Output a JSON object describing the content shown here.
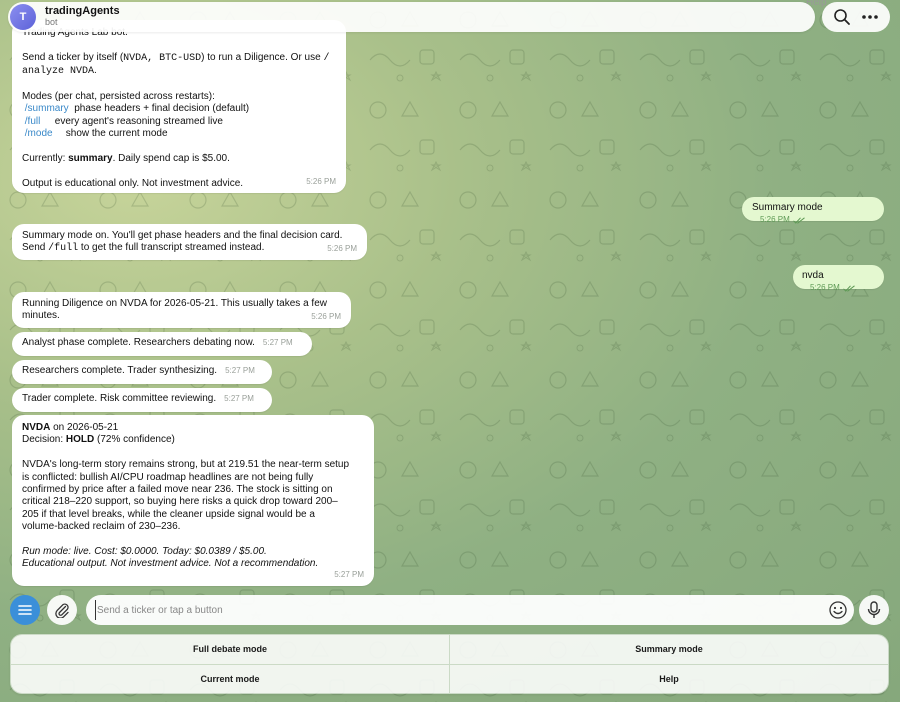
{
  "header": {
    "avatar_letter": "T",
    "title": "tradingAgents",
    "subtitle": "bot",
    "ghost_text": "Help",
    "icons": [
      "search-icon",
      "more-dots-icon"
    ]
  },
  "messages": {
    "welcome": {
      "line1": "Trading Agents Lab bot.",
      "line2a": "Send a ticker by itself (",
      "line2b": "NVDA, BTC-USD",
      "line2c": ") to run a Diligence. Or use ",
      "line2d": "/",
      "line3": "analyze NVDA",
      "line3b": ".",
      "modes_heading": "Modes (per chat, persisted across restarts):",
      "mode_rows": [
        {
          "cmd": "/summary",
          "desc": "phase headers + final decision (default)"
        },
        {
          "cmd": "/full",
          "desc": "every agent's reasoning streamed live"
        },
        {
          "cmd": "/mode",
          "desc": "show the current mode"
        }
      ],
      "currently_prefix": "Currently: ",
      "currently_value": "summary",
      "currently_suffix": ". Daily spend cap is $5.00.",
      "disclaimer": "Output is educational only. Not investment advice.",
      "time": "5:26 PM"
    },
    "out_summary": {
      "text": "Summary mode",
      "time": "5:26 PM"
    },
    "summary_on": {
      "line1": "Summary mode on. You'll get phase headers and the final decision card.",
      "line2a": "Send ",
      "line2b": "/full",
      "line2c": " to get the full transcript streamed instead.",
      "time": "5:26 PM"
    },
    "out_nvda": {
      "text": "nvda",
      "time": "5:26 PM"
    },
    "running": {
      "line1": "Running Diligence on NVDA for 2026-05-21. This usually takes a few",
      "line2": "minutes.",
      "time": "5:26 PM"
    },
    "analyst": {
      "text": "Analyst phase complete. Researchers debating now.",
      "time": "5:27 PM"
    },
    "researchers": {
      "text": "Researchers complete. Trader synthesizing.",
      "time": "5:27 PM"
    },
    "trader": {
      "text": "Trader complete. Risk committee reviewing.",
      "time": "5:27 PM"
    },
    "decision": {
      "ticker": "NVDA",
      "date_text": " on 2026-05-21",
      "decision_label": "Decision: ",
      "decision_value": "HOLD",
      "confidence": " (72% confidence)",
      "body": [
        "NVDA's long-term story remains strong, but at 219.51 the near-term setup",
        "is conflicted: bullish AI/CPU roadmap headlines are not being fully",
        "confirmed by price after a failed move near 236. The stock is sitting on",
        "critical 218–220 support, so buying here risks a quick drop toward 200–",
        "205 if that level breaks, while the cleaner upside signal would be a",
        "volume-backed reclaim of 230–236."
      ],
      "footer1": "Run mode: live. Cost: $0.0000. Today: $0.0389 / $5.00.",
      "footer2": "Educational output. Not investment advice. Not a recommendation.",
      "time": "5:27 PM"
    }
  },
  "composer": {
    "placeholder": "Send a ticker or tap a button",
    "icons": [
      "menu-icon",
      "paperclip-icon",
      "emoji-icon",
      "microphone-icon"
    ]
  },
  "keyboard": {
    "buttons": [
      "Full debate mode",
      "Summary mode",
      "Current mode",
      "Help"
    ]
  },
  "colors": {
    "accent": "#3b8fd9",
    "link": "#3a89c9",
    "outgoing_bubble": "#e4f8d0",
    "incoming_bubble": "#ffffff"
  }
}
